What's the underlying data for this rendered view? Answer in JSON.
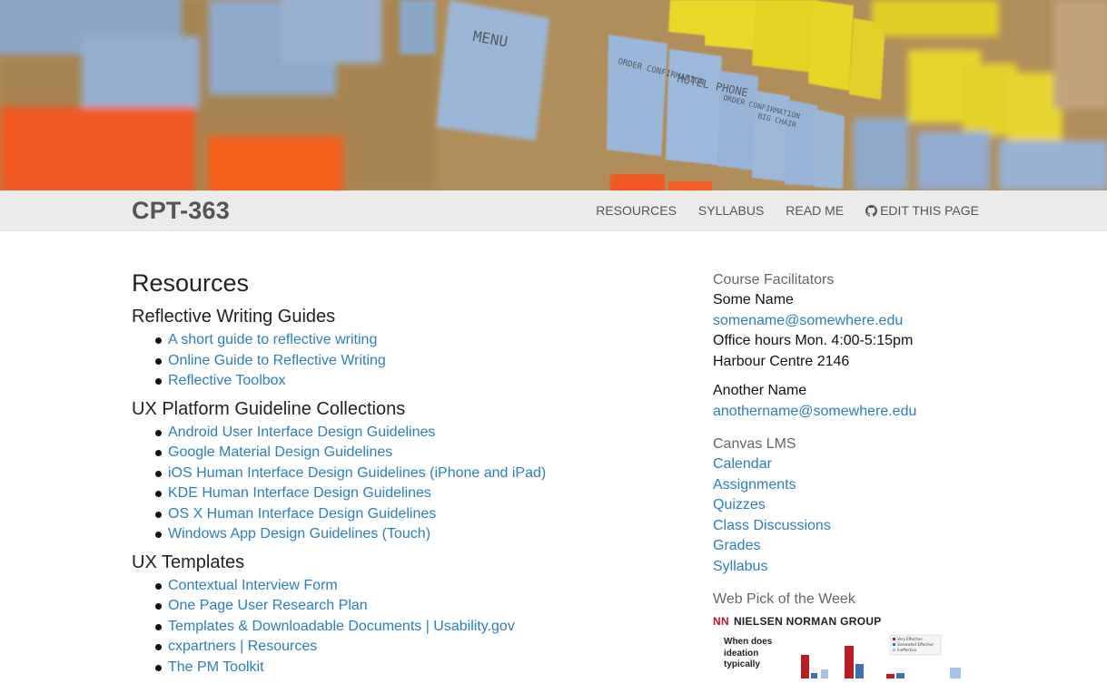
{
  "site": {
    "brand": "CPT-363"
  },
  "nav": {
    "items": [
      {
        "label": "RESOURCES"
      },
      {
        "label": "SYLLABUS"
      },
      {
        "label": "READ ME"
      },
      {
        "label": "EDIT THIS PAGE",
        "icon": "github-icon"
      }
    ]
  },
  "hero": {
    "note_texts": [
      "MENU",
      "ORDER CONFIRMATION",
      "HOTEL PHONE",
      "ORDER CONFIRMATION",
      "BIG CHAIR"
    ]
  },
  "main": {
    "title": "Resources",
    "sections": [
      {
        "title": "Reflective Writing Guides",
        "links": [
          "A short guide to reflective writing",
          "Online Guide to Reflective Writing",
          "Reflective Toolbox"
        ]
      },
      {
        "title": "UX Platform Guideline Collections",
        "links": [
          "Android User Interface Design Guidelines",
          "Google Material Design Guidelines",
          "iOS Human Interface Design Guidelines (iPhone and iPad)",
          "KDE Human Interface Design Guidelines",
          "OS X Human Interface Design Guidelines",
          "Windows App Design Guidelines (Touch)"
        ]
      },
      {
        "title": "UX Templates",
        "links": [
          "Contextual Interview Form",
          "One Page User Research Plan",
          "Templates & Downloadable Documents | Usability.gov",
          "cxpartners | Resources",
          "The PM Toolkit"
        ]
      }
    ]
  },
  "sidebar": {
    "facilitators": {
      "heading": "Course Facilitators",
      "person1": {
        "name": "Some Name",
        "email": "somename@somewhere.edu",
        "hours": "Office hours Mon. 4:00-5:15pm",
        "location": "Harbour Centre 2146"
      },
      "person2": {
        "name": "Another Name",
        "email": "anothername@somewhere.edu"
      }
    },
    "canvas": {
      "heading": "Canvas LMS",
      "links": [
        "Calendar",
        "Assignments",
        "Quizzes",
        "Class Discussions",
        "Grades",
        "Syllabus"
      ]
    },
    "webpick": {
      "heading": "Web Pick of the Week",
      "logo_mark": "NN",
      "logo_text": "NIELSEN NORMAN GROUP",
      "teaser_lines": [
        "When does",
        "ideation",
        "typically"
      ],
      "legend": [
        "Very Effective",
        "Somewhat Effective",
        "Ineffective"
      ],
      "colors": {
        "red": "#b81e23",
        "blue": "#3f6fb5",
        "light_blue": "#a9c1e3"
      }
    }
  },
  "colors": {
    "link": "#2a7ec4",
    "navbar_bg": "#ebebeb",
    "brand_text": "#555555"
  }
}
